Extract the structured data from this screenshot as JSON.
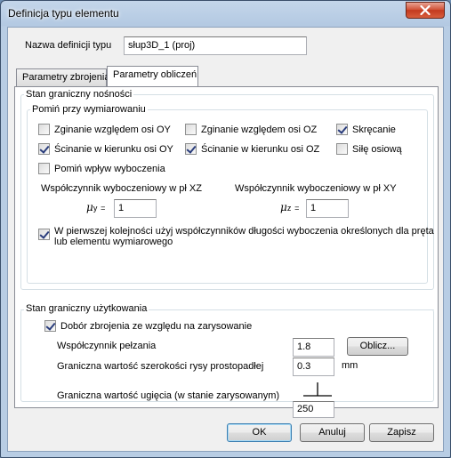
{
  "window": {
    "title": "Definicja typu elementu"
  },
  "header": {
    "definition_name_label": "Nazwa definicji typu",
    "definition_name_value": "słup3D_1 (proj)"
  },
  "tabs": [
    {
      "label": "Parametry zbrojenia",
      "active": false
    },
    {
      "label": "Parametry obliczeń",
      "active": true
    }
  ],
  "uls": {
    "title": "Stan graniczny nośności",
    "omit_group": {
      "title": "Pomiń przy wymiarowaniu",
      "checkboxes": [
        {
          "label": "Zginanie względem osi OY",
          "checked": false
        },
        {
          "label": "Zginanie względem osi OZ",
          "checked": false
        },
        {
          "label": "Skręcanie",
          "checked": true
        },
        {
          "label": "Ścinanie w kierunku osi OY",
          "checked": true
        },
        {
          "label": "Ścinanie w kierunku osi OZ",
          "checked": true
        },
        {
          "label": "Siłę osiową",
          "checked": false
        },
        {
          "label": "Pomiń wpływ wyboczenia",
          "checked": false
        }
      ],
      "buckling_xz_label": "Współczynnik wyboczeniowy w pł XZ",
      "buckling_xy_label": "Współczynnik wyboczeniowy w pł XY",
      "mu_y_symbol": "μ",
      "mu_y_sub": "y",
      "mu_z_symbol": "μ",
      "mu_z_sub": "z",
      "equals": "=",
      "mu_y_value": "1",
      "mu_z_value": "1",
      "length_coeff_checkbox": {
        "label_line1": "W pierwszej kolejności użyj współczynników długości wyboczenia określonych dla pręta",
        "label_line2": "lub elementu wymiarowego",
        "checked": true
      }
    }
  },
  "sls": {
    "title": "Stan graniczny użytkowania",
    "crack_checkbox": {
      "label": "Dobór zbrojenia ze względu na zarysowanie",
      "checked": true
    },
    "creep_label": "Współczynnik pełzania",
    "creep_value": "1.8",
    "calc_button": "Oblicz...",
    "crack_width_label": "Graniczna wartość szerokości rysy prostopadłej",
    "crack_width_value": "0.3",
    "crack_width_unit": "mm",
    "deflection_label": "Graniczna wartość ugięcia (w stanie zarysowanym)",
    "deflection_value": "250"
  },
  "footer": {
    "ok": "OK",
    "cancel": "Anuluj",
    "save": "Zapisz"
  }
}
